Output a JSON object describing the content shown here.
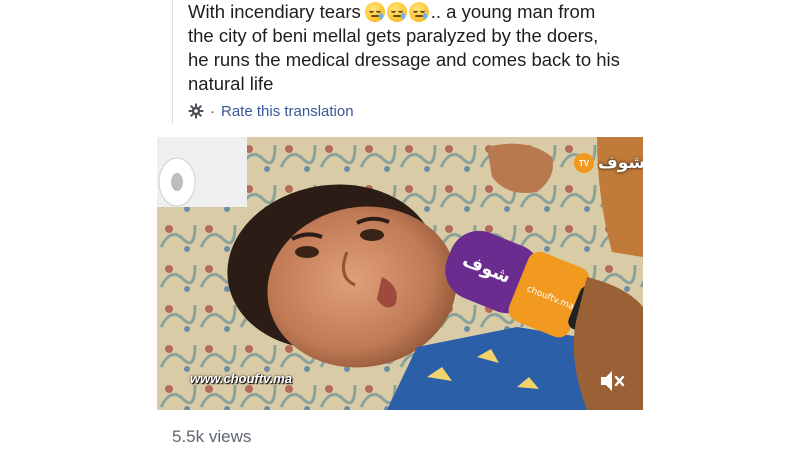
{
  "post": {
    "line1_before": "With incendiary tears",
    "line1_after": ".. a young man from",
    "line2": "the city of beni mellal gets paralyzed by the doers,",
    "line3": "he runs the medical dressage and comes back to his",
    "line4": "natural life",
    "emojis": [
      "crying-face",
      "crying-face",
      "crying-face"
    ]
  },
  "translation": {
    "separator": "·",
    "rate_label": "Rate this translation"
  },
  "video": {
    "watermark": "www.chouftv.ma",
    "logo_tv": "TV",
    "logo_text": "شوف",
    "mic_logo": "شوف",
    "mic_site": "chouftv.ma"
  },
  "stats": {
    "views": "5.5k views"
  },
  "colors": {
    "link": "#385898",
    "text": "#1c1e21",
    "muted": "#606770",
    "accent": "#f29a1f",
    "mic_purple": "#6a2d8f"
  }
}
